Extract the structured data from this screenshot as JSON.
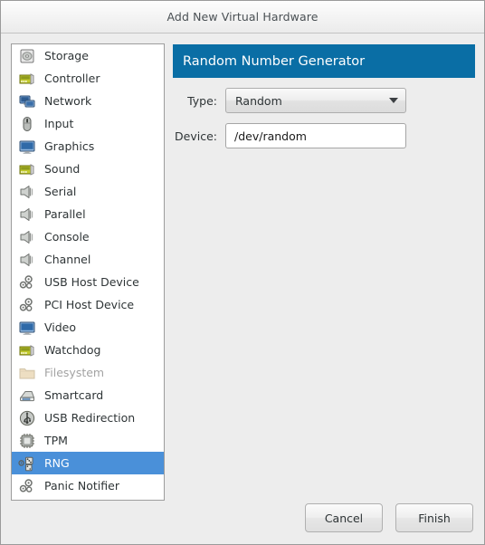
{
  "window": {
    "title": "Add New Virtual Hardware"
  },
  "colors": {
    "header_blue": "#0a6ea5",
    "selection_blue": "#4a90d9",
    "window_bg": "#ededed",
    "list_bg": "#ffffff"
  },
  "sidebar": {
    "items": [
      {
        "label": "Storage",
        "icon": "storage-icon",
        "selected": false,
        "disabled": false
      },
      {
        "label": "Controller",
        "icon": "controller-icon",
        "selected": false,
        "disabled": false
      },
      {
        "label": "Network",
        "icon": "network-icon",
        "selected": false,
        "disabled": false
      },
      {
        "label": "Input",
        "icon": "mouse-icon",
        "selected": false,
        "disabled": false
      },
      {
        "label": "Graphics",
        "icon": "display-icon",
        "selected": false,
        "disabled": false
      },
      {
        "label": "Sound",
        "icon": "sound-card-icon",
        "selected": false,
        "disabled": false
      },
      {
        "label": "Serial",
        "icon": "serial-port-icon",
        "selected": false,
        "disabled": false
      },
      {
        "label": "Parallel",
        "icon": "parallel-port-icon",
        "selected": false,
        "disabled": false
      },
      {
        "label": "Console",
        "icon": "console-port-icon",
        "selected": false,
        "disabled": false
      },
      {
        "label": "Channel",
        "icon": "channel-port-icon",
        "selected": false,
        "disabled": false
      },
      {
        "label": "USB Host Device",
        "icon": "usb-host-icon",
        "selected": false,
        "disabled": false
      },
      {
        "label": "PCI Host Device",
        "icon": "pci-host-icon",
        "selected": false,
        "disabled": false
      },
      {
        "label": "Video",
        "icon": "video-icon",
        "selected": false,
        "disabled": false
      },
      {
        "label": "Watchdog",
        "icon": "watchdog-icon",
        "selected": false,
        "disabled": false
      },
      {
        "label": "Filesystem",
        "icon": "folder-icon",
        "selected": false,
        "disabled": true
      },
      {
        "label": "Smartcard",
        "icon": "smartcard-icon",
        "selected": false,
        "disabled": false
      },
      {
        "label": "USB Redirection",
        "icon": "usb-plug-icon",
        "selected": false,
        "disabled": false
      },
      {
        "label": "TPM",
        "icon": "chip-icon",
        "selected": false,
        "disabled": false
      },
      {
        "label": "RNG",
        "icon": "rng-icon",
        "selected": true,
        "disabled": false
      },
      {
        "label": "Panic Notifier",
        "icon": "panic-notifier-icon",
        "selected": false,
        "disabled": false
      }
    ]
  },
  "detail": {
    "header": "Random Number Generator",
    "fields": [
      {
        "label": "Type:",
        "kind": "combo",
        "value": "Random",
        "options": [
          "Random"
        ]
      },
      {
        "label": "Device:",
        "kind": "text",
        "value": "/dev/random",
        "placeholder": ""
      }
    ]
  },
  "footer": {
    "cancel_label": "Cancel",
    "finish_label": "Finish"
  }
}
